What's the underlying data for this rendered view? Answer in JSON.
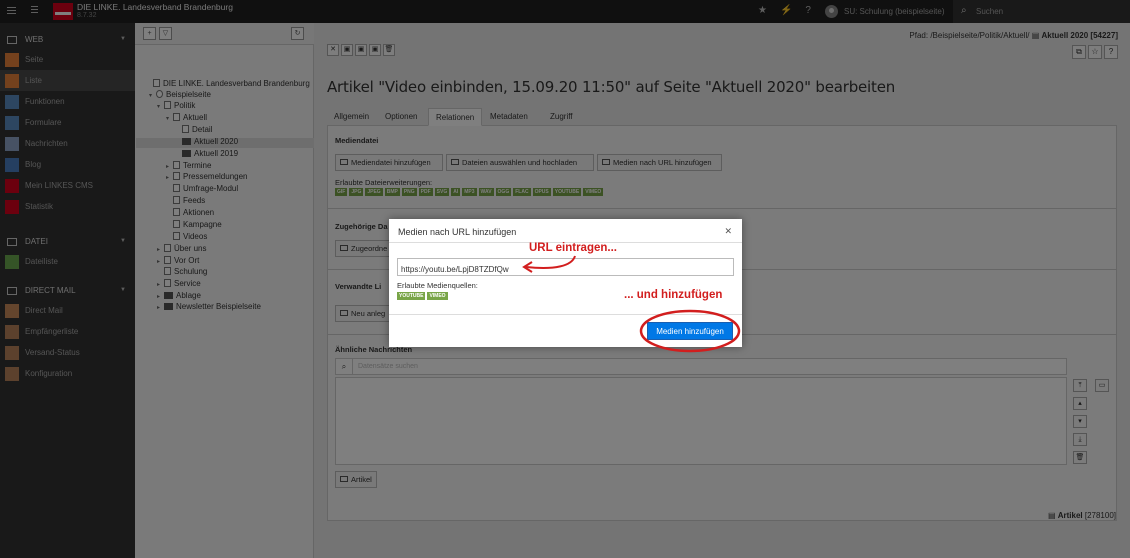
{
  "topbar": {
    "site_name": "DIE LINKE. Landesverband Brandenburg",
    "version": "8.7.32",
    "user": "SU: Schulung (beispielseite)",
    "search_label": "Suchen"
  },
  "sidebar": {
    "groups": [
      {
        "label": "WEB",
        "items": [
          "Seite",
          "Liste",
          "Funktionen",
          "Formulare",
          "Nachrichten",
          "Blog",
          "Mein LINKES CMS",
          "Statistik"
        ]
      },
      {
        "label": "DATEI",
        "items": [
          "Dateiliste"
        ]
      },
      {
        "label": "DIRECT MAIL",
        "items": [
          "Direct Mail",
          "Empfängerliste",
          "Versand-Status",
          "Konfiguration"
        ]
      }
    ],
    "item_colors": {
      "Seite": "#e8833a",
      "Liste": "#e8833a",
      "Funktionen": "#5b8dc2",
      "Formulare": "#5b8dc2",
      "Nachrichten": "#8fa4c8",
      "Blog": "#4a7ec2",
      "Mein LINKES CMS": "#d6001c",
      "Statistik": "#d6001c",
      "Dateiliste": "#6aa84f",
      "Direct Mail": "#c88a5a"
    }
  },
  "tree": {
    "root": "DIE LINKE. Landesverband Brandenburg",
    "nodes": [
      "Beispielseite",
      "Politik",
      "Aktuell",
      "Detail",
      "Aktuell 2020",
      "Aktuell 2019",
      "Termine",
      "Pressemeldungen",
      "Umfrage-Modul",
      "Feeds",
      "Aktionen",
      "Kampagne",
      "Videos",
      "Über uns",
      "Vor Ort",
      "Schulung",
      "Service",
      "Ablage",
      "Newsletter Beispielseite"
    ]
  },
  "main": {
    "path_prefix": "Pfad: /Beispielseite/Politik/Aktuell/",
    "path_page": "Aktuell 2020 [54227]",
    "title": "Artikel \"Video einbinden, 15.09.20 11:50\" auf Seite \"Aktuell 2020\" bearbeiten",
    "tabs": [
      "Allgemein",
      "Optionen",
      "Relationen",
      "Metadaten",
      "Zugriff"
    ],
    "active_tab": "Relationen",
    "mediendatei": {
      "title": "Mediendatei",
      "btn_add": "Mediendatei hinzufügen",
      "btn_upload": "Dateien auswählen und hochladen",
      "btn_url": "Medien nach URL hinzufügen",
      "allowed_label": "Erlaubte Dateierweiterungen:",
      "extensions": [
        "GIF",
        "JPG",
        "JPEG",
        "BMP",
        "PNG",
        "PDF",
        "SVG",
        "AI",
        "MP3",
        "WAV",
        "OGG",
        "FLAC",
        "OPUS",
        "YOUTUBE",
        "VIMEO"
      ]
    },
    "zugehoerige": {
      "title": "Zugehörige Da",
      "btn": "Zugeordne"
    },
    "verwandte": {
      "title": "Verwandte Li",
      "btn": "Neu anleg"
    },
    "aehnliche": {
      "title": "Ähnliche Nachrichten",
      "search_placeholder": "Datensätze suchen",
      "btn": "Artikel"
    },
    "footer_label": "Artikel",
    "footer_id": "[278100]"
  },
  "modal": {
    "title": "Medien nach URL hinzufügen",
    "url_value": "https://youtu.be/LpjD8TZDfQw",
    "sources_label": "Erlaubte Medienquellen:",
    "sources": [
      "YOUTUBE",
      "VIMEO"
    ],
    "submit": "Medien hinzufügen"
  },
  "annotations": {
    "url_hint": "URL eintragen...",
    "add_hint": "... und hinzufügen"
  }
}
